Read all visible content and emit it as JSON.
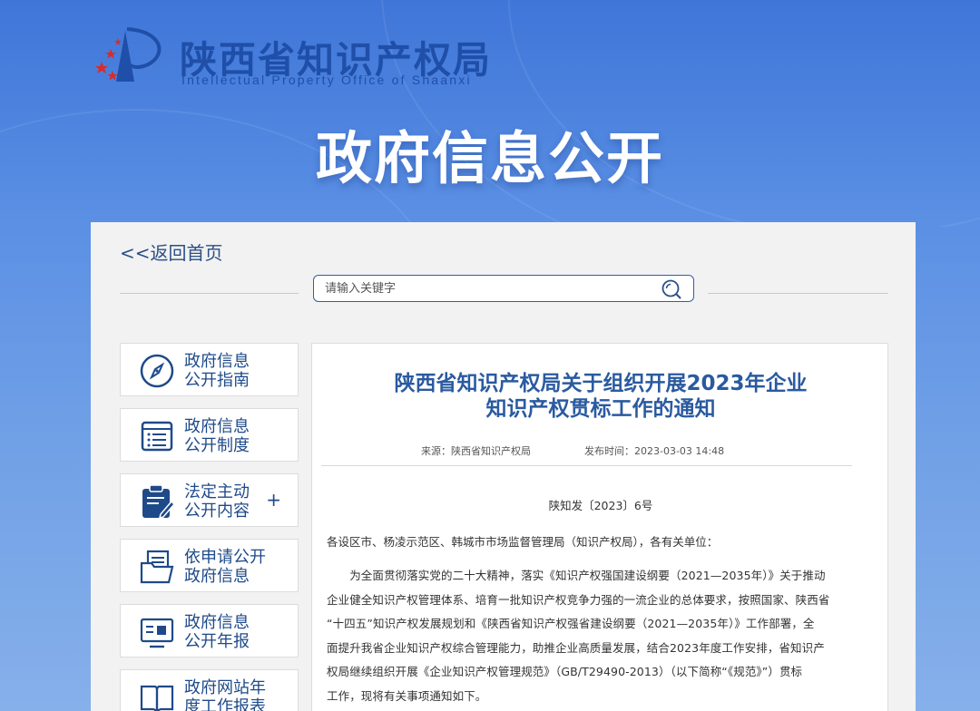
{
  "site": {
    "name_cn": "陕西省知识产权局",
    "name_en": "Intellectual Property Office of Shaanxi",
    "banner_title": "政府信息公开"
  },
  "nav": {
    "back_label": "<<返回首页"
  },
  "search": {
    "placeholder": "请输入关键字",
    "value": "",
    "icon": "search-icon"
  },
  "sidebar": {
    "items": [
      {
        "line1": "政府信息",
        "line2": "公开指南",
        "icon": "compass-icon",
        "expand": ""
      },
      {
        "line1": "政府信息",
        "line2": "公开制度",
        "icon": "list-document-icon",
        "expand": ""
      },
      {
        "line1": "法定主动",
        "line2": "公开内容",
        "icon": "clipboard-edit-icon",
        "expand": "+"
      },
      {
        "line1": "依申请公开",
        "line2": "政府信息",
        "icon": "folder-document-icon",
        "expand": ""
      },
      {
        "line1": "政府信息",
        "line2": "公开年报",
        "icon": "monitor-report-icon",
        "expand": ""
      },
      {
        "line1": "政府网站年",
        "line2": "度工作报表",
        "icon": "book-icon",
        "expand": ""
      }
    ]
  },
  "article": {
    "title_line1": "陕西省知识产权局关于组织开展2023年企业",
    "title_line2": "知识产权贯标工作的通知",
    "source": "来源：陕西省知识产权局",
    "published": "发布时间：2023-03-03 14:48",
    "doc_number": "陕知发〔2023〕6号",
    "salutation": "各设区市、杨凌示范区、韩城市市场监督管理局（知识产权局），各有关单位：",
    "body_lines": [
      "　　为全面贯彻落实党的二十大精神，落实《知识产权强国建设纲要（2021—2035年）》关于推动",
      "企业健全知识产权管理体系、培育一批知识产权竞争力强的一流企业的总体要求，按照国家、陕西省",
      "“十四五”知识产权发展规划和《陕西省知识产权强省建设纲要（2021—2035年）》工作部署，全",
      "面提升我省企业知识产权综合管理能力，助推企业高质量发展，结合2023年度工作安排，省知识产",
      "权局继续组织开展《企业知识产权管理规范》（GB/T29490-2013）（以下简称“《规范》”）贯标",
      "工作，现将有关事项通知如下。"
    ]
  },
  "colors": {
    "brand_blue": "#1f4fa8",
    "title_blue": "#2a5aa0",
    "star_red": "#d92b2b",
    "panel_bg": "#f2f2f2"
  }
}
